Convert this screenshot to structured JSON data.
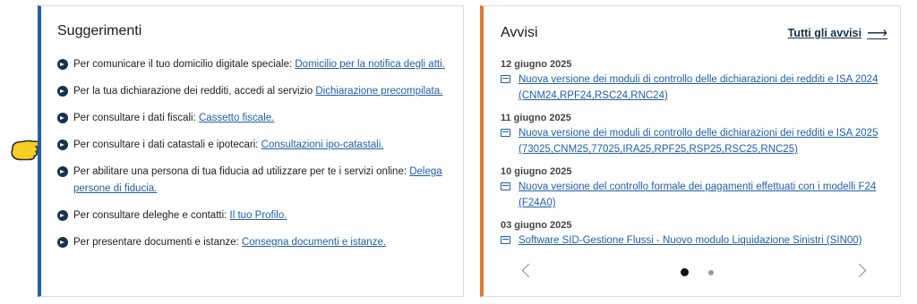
{
  "suggestions": {
    "title": "Suggerimenti",
    "items": [
      {
        "text": "Per comunicare il tuo domicilio digitale speciale: ",
        "link": "Domicilio per la notifica degli atti."
      },
      {
        "text": "Per la tua dichiarazione dei redditi, accedi al servizio ",
        "link": "Dichiarazione precompilata."
      },
      {
        "text": "Per consultare i dati fiscali: ",
        "link": "Cassetto fiscale."
      },
      {
        "text": "Per consultare i dati catastali e ipotecari: ",
        "link": "Consultazioni ipo-catastali."
      },
      {
        "text": "Per abilitare una persona di tua fiducia ad utilizzare per te i servizi online: ",
        "link": "Delega persone di fiducia."
      },
      {
        "text": "Per consultare deleghe e contatti: ",
        "link": "Il tuo Profilo."
      },
      {
        "text": "Per presentare documenti e istanze: ",
        "link": "Consegna documenti e istanze."
      }
    ]
  },
  "notices": {
    "title": "Avvisi",
    "all_link": "Tutti gli avvisi",
    "items": [
      {
        "date": "12 giugno 2025",
        "link": "Nuova versione dei moduli di controllo delle dichiarazioni dei redditi e ISA 2024 (CNM24,RPF24,RSC24,RNC24)"
      },
      {
        "date": "11 giugno 2025",
        "link": "Nuova versione dei moduli di controllo delle dichiarazioni dei redditi e ISA 2025 (73025,CNM25,77025,IRA25,RPF25,RSP25,RSC25,RNC25)"
      },
      {
        "date": "10 giugno 2025",
        "link": "Nuova versione del controllo formale dei pagamenti effettuati con i modelli F24 (F24A0)"
      },
      {
        "date": "03 giugno 2025",
        "link": "Software SID-Gestione Flussi - Nuovo modulo Liquidazione Sinistri (SIN00)"
      }
    ],
    "carousel": {
      "active_page": 1,
      "total_pages": 2
    }
  },
  "colors": {
    "left_accent": "#1f5fa8",
    "right_accent": "#e07a32",
    "link": "#1f5fa8"
  }
}
